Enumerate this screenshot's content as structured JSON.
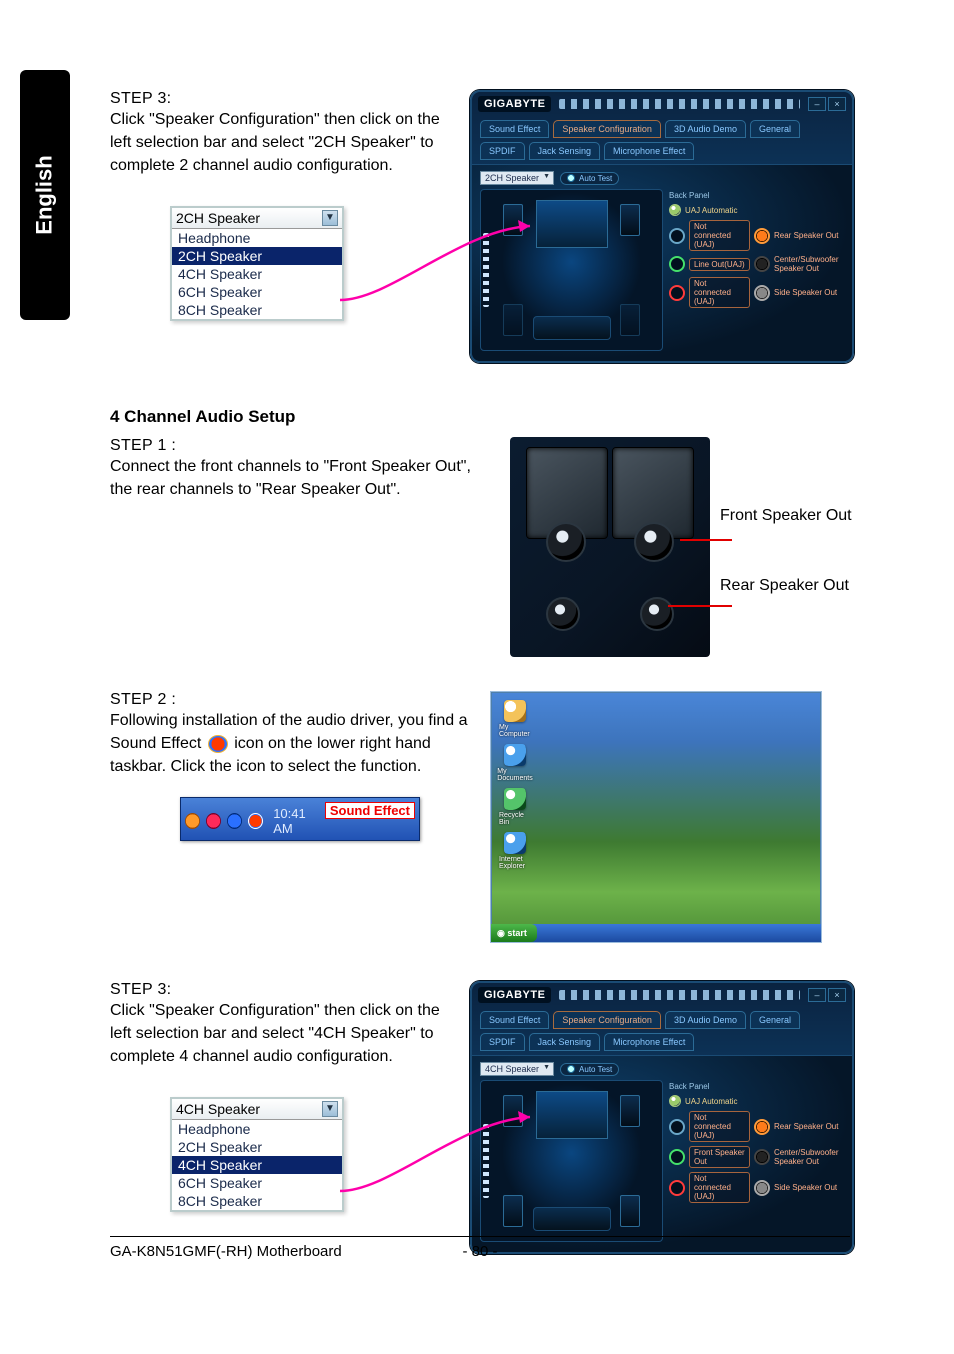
{
  "language_tab": "English",
  "section1": {
    "step": "STEP 3:",
    "body": "Click \"Speaker Configuration\" then click on the left selection bar and select \"2CH Speaker\" to complete 2 channel audio configuration.",
    "dropdown": {
      "value": "2CH Speaker",
      "options": [
        "Headphone",
        "2CH Speaker",
        "4CH Speaker",
        "6CH Speaker",
        "8CH Speaker"
      ],
      "selected": "2CH Speaker"
    }
  },
  "app": {
    "brand": "GIGABYTE",
    "tabs_row1": [
      "Sound Effect",
      "Speaker Configuration",
      "3D Audio Demo",
      "General"
    ],
    "tabs_row2": [
      "SPDIF",
      "Jack Sensing",
      "Microphone Effect"
    ],
    "auto_test": "Auto Test",
    "back_panel": "Back Panel",
    "uaj": "UAJ Automatic",
    "speaker_select_2ch": "2CH Speaker",
    "speaker_select_4ch": "4CH Speaker",
    "jack_labels": {
      "rear": "Rear Speaker Out",
      "center": "Center/Subwoofer Speaker Out",
      "side": "Side Speaker Out"
    },
    "jacks_2ch": [
      {
        "state": "Not connected (UAJ)",
        "color": "blue"
      },
      {
        "state": "Line Out(UAJ)",
        "color": "green"
      },
      {
        "state": "Not connected (UAJ)",
        "color": "red"
      }
    ],
    "jacks_4ch": [
      {
        "state": "Not connected (UAJ)",
        "color": "blue"
      },
      {
        "state": "Front Speaker Out",
        "color": "green"
      },
      {
        "state": "Not connected (UAJ)",
        "color": "red"
      }
    ]
  },
  "section2": {
    "title": "4 Channel Audio Setup",
    "step1_label": "STEP 1 :",
    "step1_body": "Connect the front channels to \"Front Speaker Out\", the rear channels to \"Rear Speaker Out\".",
    "photo_labels": {
      "front": "Front Speaker Out",
      "rear": "Rear Speaker Out"
    },
    "step2_label": "STEP 2 :",
    "step2_before_icon": "Following installation of the audio driver, you find a Sound Effect ",
    "step2_after_icon": " icon on the lower right hand taskbar. Click the icon to select the function.",
    "tray": {
      "label": "Sound Effect",
      "time": "10:41 AM"
    },
    "step3_label": "STEP 3:",
    "step3_body": "Click \"Speaker Configuration\" then click on the left selection bar and select \"4CH Speaker\" to complete 4 channel audio configuration.",
    "dropdown": {
      "value": "4CH Speaker",
      "options": [
        "Headphone",
        "2CH Speaker",
        "4CH Speaker",
        "6CH Speaker",
        "8CH Speaker"
      ],
      "selected": "4CH Speaker"
    }
  },
  "desktop_icons": [
    "My Computer",
    "My Documents",
    "Recycle Bin",
    "Internet Explorer"
  ],
  "footer": {
    "left": "GA-K8N51GMF(-RH) Motherboard",
    "page": "- 80 -"
  }
}
